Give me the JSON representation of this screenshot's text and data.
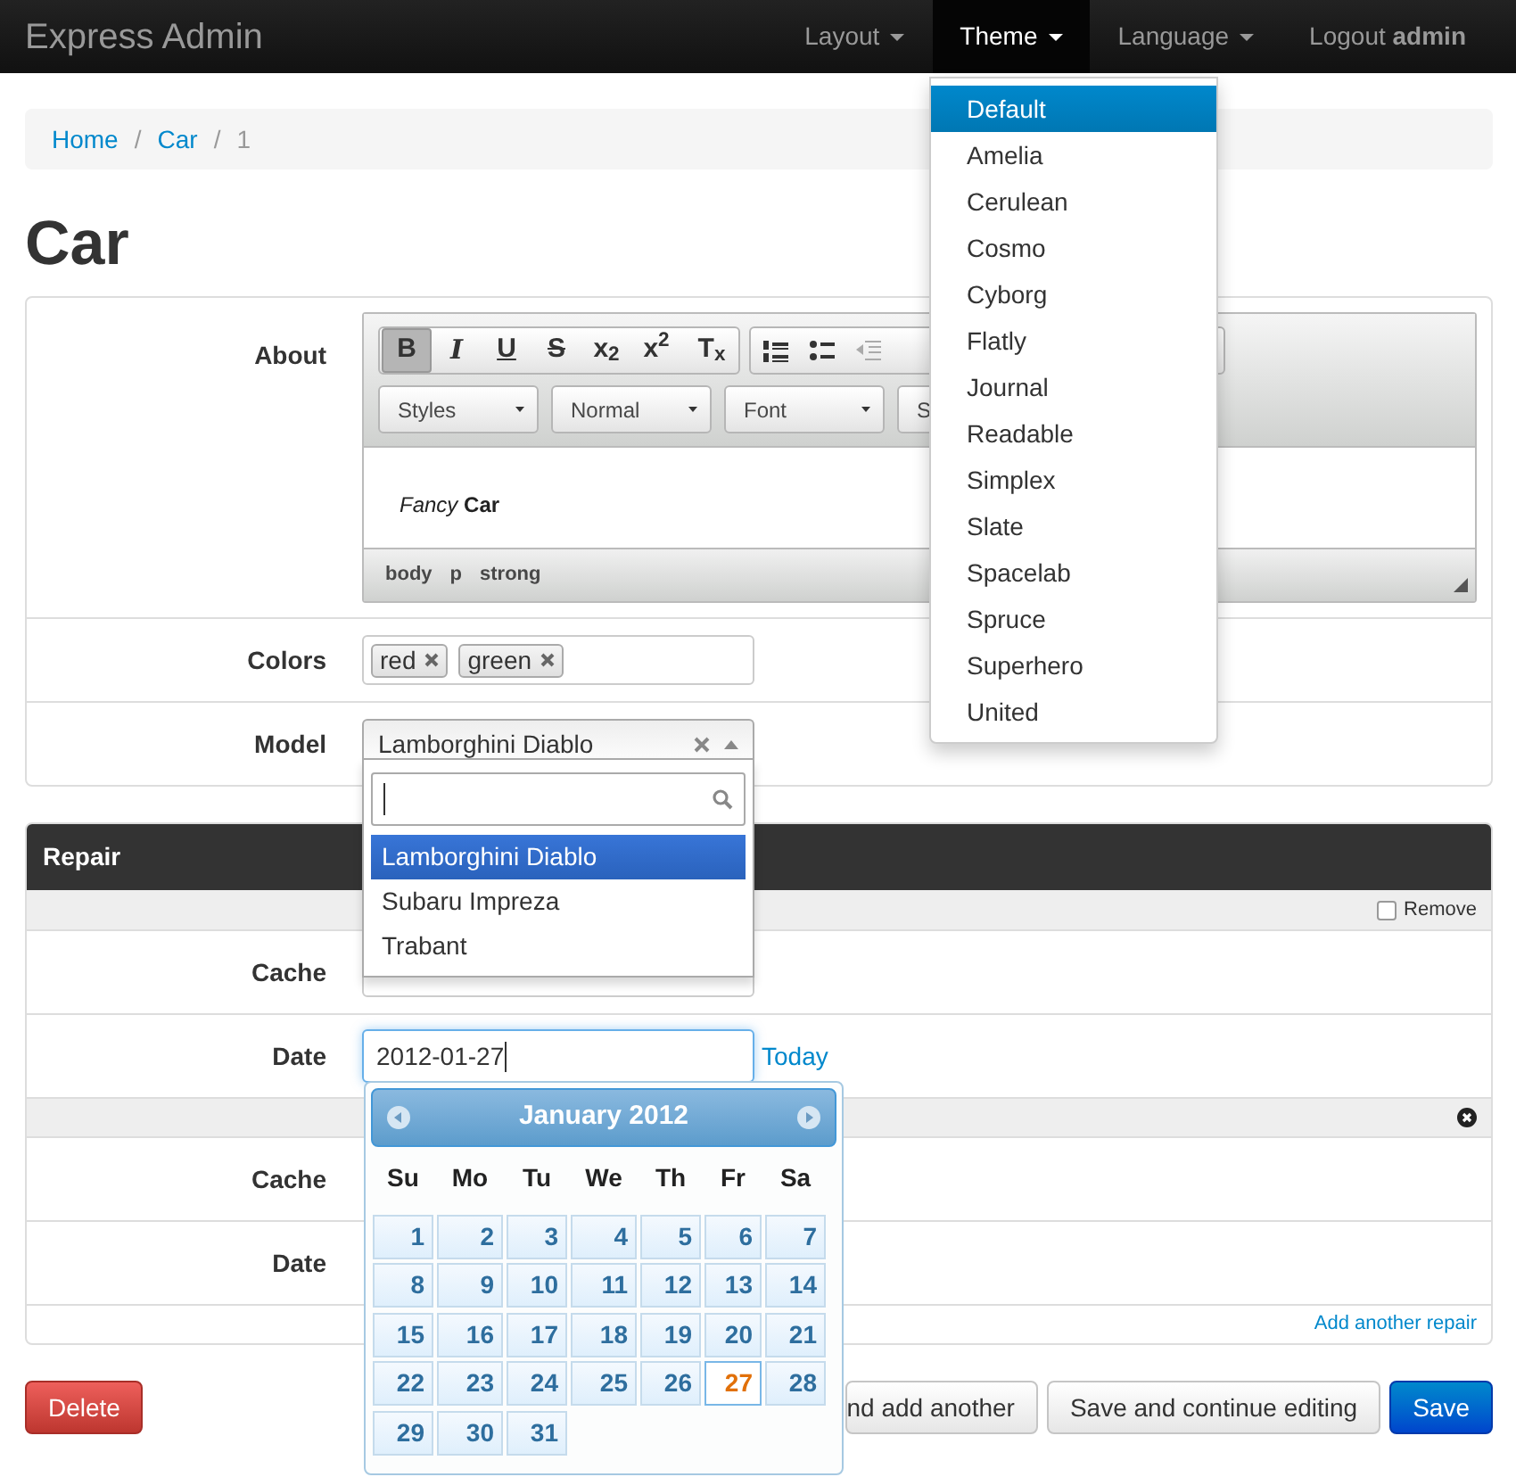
{
  "navbar": {
    "brand": "Express Admin",
    "items": [
      {
        "label": "Layout",
        "caret": true,
        "selected": false
      },
      {
        "label": "Theme",
        "caret": true,
        "selected": true
      },
      {
        "label": "Language",
        "caret": true,
        "selected": false
      },
      {
        "label": "Logout **admin**",
        "caret": false,
        "selected": false
      }
    ]
  },
  "theme_menu": {
    "items": [
      {
        "label": "Default",
        "selected": true
      },
      {
        "label": "Amelia",
        "selected": false
      },
      {
        "label": "Cerulean",
        "selected": false
      },
      {
        "label": "Cosmo",
        "selected": false
      },
      {
        "label": "Cyborg",
        "selected": false
      },
      {
        "label": "Flatly",
        "selected": false
      },
      {
        "label": "Journal",
        "selected": false
      },
      {
        "label": "Readable",
        "selected": false
      },
      {
        "label": "Simplex",
        "selected": false
      },
      {
        "label": "Slate",
        "selected": false
      },
      {
        "label": "Spacelab",
        "selected": false
      },
      {
        "label": "Spruce",
        "selected": false
      },
      {
        "label": "Superhero",
        "selected": false
      },
      {
        "label": "United",
        "selected": false
      }
    ]
  },
  "breadcrumb": {
    "separator": "/",
    "items": [
      {
        "label": "Home",
        "kind": "link"
      },
      {
        "label": "Car",
        "kind": "link"
      },
      {
        "label": "1",
        "kind": "current"
      }
    ]
  },
  "title": "Car",
  "form": {
    "rows": [
      {
        "label": "About",
        "kind": "editor",
        "editor": {
          "buttons": [
            {
              "label": "B",
              "selected": true
            },
            {
              "label": "I",
              "selected": false
            },
            {
              "label": "U",
              "selected": false
            },
            {
              "label": "S",
              "selected": false
            },
            {
              "label": "x$_{2}$",
              "selected": false
            },
            {
              "label": "x$^{2}$",
              "selected": false
            },
            {
              "label": "T$_{x}$",
              "selected": false
            }
          ],
          "combos": [
            "Styles",
            "Normal",
            "Font",
            "S"
          ],
          "content": "*Fancy* **Car**",
          "path": [
            "body",
            "p",
            "strong"
          ]
        }
      },
      {
        "label": "Colors",
        "kind": "tags",
        "tags": [
          "red",
          "green"
        ]
      },
      {
        "label": "Model",
        "kind": "select",
        "value": "Lamborghini Diablo",
        "expanded": true,
        "options": [
          {
            "label": "Lamborghini Diablo",
            "selected": true
          },
          {
            "label": "Subaru Impreza",
            "selected": false
          },
          {
            "label": "Trabant",
            "selected": false
          }
        ]
      }
    ]
  },
  "repair": {
    "title": "Repair",
    "items": [
      {
        "kind": "checkbox",
        "remove": "Remove",
        "checked": false,
        "rows": [
          {
            "label": "Cache",
            "kind": "input"
          },
          {
            "label": "Date",
            "kind": "date",
            "value": "2012-01-27",
            "link": "Today"
          }
        ]
      },
      {
        "kind": "close",
        "rows": [
          {
            "label": "Cache"
          },
          {
            "label": "Date"
          }
        ]
      }
    ],
    "add_link": "Add another repair"
  },
  "calendar": {
    "month": "January 2012",
    "weekdays": [
      "Su",
      "Mo",
      "Tu",
      "We",
      "Th",
      "Fr",
      "Sa"
    ],
    "days": [
      {
        "label": "1",
        "selected": false
      },
      {
        "label": "2",
        "selected": false
      },
      {
        "label": "3",
        "selected": false
      },
      {
        "label": "4",
        "selected": false
      },
      {
        "label": "5",
        "selected": false
      },
      {
        "label": "6",
        "selected": false
      },
      {
        "label": "7",
        "selected": false
      },
      {
        "label": "8",
        "selected": false
      },
      {
        "label": "9",
        "selected": false
      },
      {
        "label": "10",
        "selected": false
      },
      {
        "label": "11",
        "selected": false
      },
      {
        "label": "12",
        "selected": false
      },
      {
        "label": "13",
        "selected": false
      },
      {
        "label": "14",
        "selected": false
      },
      {
        "label": "15",
        "selected": false
      },
      {
        "label": "16",
        "selected": false
      },
      {
        "label": "17",
        "selected": false
      },
      {
        "label": "18",
        "selected": false
      },
      {
        "label": "19",
        "selected": false
      },
      {
        "label": "20",
        "selected": false
      },
      {
        "label": "21",
        "selected": false
      },
      {
        "label": "22",
        "selected": false
      },
      {
        "label": "23",
        "selected": false
      },
      {
        "label": "24",
        "selected": false
      },
      {
        "label": "25",
        "selected": false
      },
      {
        "label": "26",
        "selected": false
      },
      {
        "label": "27",
        "selected": true
      },
      {
        "label": "28",
        "selected": false
      },
      {
        "label": "29",
        "selected": false
      },
      {
        "label": "30",
        "selected": false
      },
      {
        "label": "31",
        "selected": false
      }
    ]
  },
  "buttons": [
    {
      "label": "Delete",
      "kind": "danger"
    },
    {
      "label": "nd add another",
      "kind": "default"
    },
    {
      "label": "Save and continue editing",
      "kind": "default"
    },
    {
      "label": "Save",
      "kind": "primary"
    }
  ]
}
